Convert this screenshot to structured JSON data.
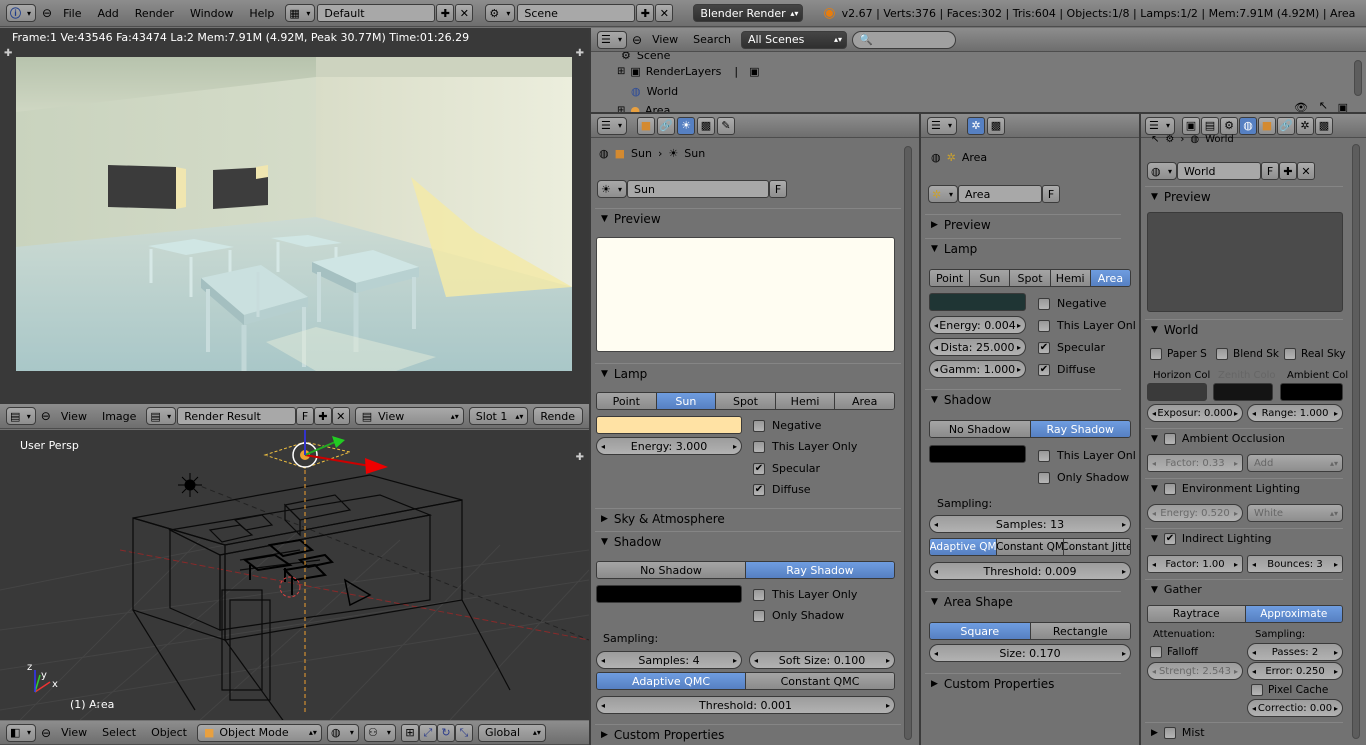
{
  "top_bar": {
    "menus": [
      "File",
      "Add",
      "Render",
      "Window",
      "Help"
    ],
    "screen_layout": "Default",
    "scene": "Scene",
    "engine": "Blender Render",
    "version_stats": "v2.67 | Verts:376 | Faces:302 | Tris:604 | Objects:1/8 | Lamps:1/2 | Mem:7.91M (4.92M) | Area"
  },
  "render_view": {
    "stats": "Frame:1 Ve:43546 Fa:43474 La:2 Mem:7.91M (4.92M, Peak 30.77M) Time:01:26.29"
  },
  "image_editor_header": {
    "menus": [
      "View",
      "Image"
    ],
    "image_name": "Render Result",
    "f_label": "F",
    "view_select": "View",
    "slot": "Slot 1",
    "render_label": "Rende"
  },
  "viewport3d": {
    "view_label": "User Persp",
    "object_label": "(1) Area",
    "axis_x": "x",
    "axis_y": "y",
    "axis_z": "z"
  },
  "viewport_header": {
    "menus": [
      "View",
      "Select",
      "Object"
    ],
    "mode": "Object Mode",
    "orientation": "Global"
  },
  "outliner": {
    "menus": [
      "View",
      "Search"
    ],
    "filter": "All Scenes",
    "items": [
      "Scene",
      "RenderLayers",
      "World",
      "Area"
    ]
  },
  "props_sun": {
    "breadcrumb": [
      "Sun",
      "Sun"
    ],
    "datablock": "Sun",
    "f_label": "F",
    "preview_title": "Preview",
    "lamp_title": "Lamp",
    "lamp_types": [
      "Point",
      "Sun",
      "Spot",
      "Hemi",
      "Area"
    ],
    "active_type": "Sun",
    "energy": "Energy: 3.000",
    "checks": [
      "Negative",
      "This Layer Only",
      "Specular",
      "Diffuse"
    ],
    "sky_title": "Sky & Atmosphere",
    "shadow_title": "Shadow",
    "shadow_types": [
      "No Shadow",
      "Ray Shadow"
    ],
    "shadow_checks": [
      "This Layer Only",
      "Only Shadow"
    ],
    "sampling_label": "Sampling:",
    "samples": "Samples: 4",
    "soft_size": "Soft Size: 0.100",
    "qmc": [
      "Adaptive QMC",
      "Constant QMC"
    ],
    "threshold": "Threshold: 0.001",
    "custom_title": "Custom Properties",
    "color_lamp": "#ffe2a4",
    "color_shadow": "#000000"
  },
  "props_area": {
    "breadcrumb": "Area",
    "datablock": "Area",
    "f_label": "F",
    "preview_title": "Preview",
    "lamp_title": "Lamp",
    "lamp_types": [
      "Point",
      "Sun",
      "Spot",
      "Hemi",
      "Area"
    ],
    "active_type": "Area",
    "checks": [
      "Negative",
      "This Layer Onl",
      "Specular",
      "Diffuse"
    ],
    "energy": "Energy: 0.004",
    "distance": "Dista: 25.000",
    "gamma": "Gamm: 1.000",
    "shadow_title": "Shadow",
    "shadow_types": [
      "No Shadow",
      "Ray Shadow"
    ],
    "shadow_checks": [
      "This Layer Onl",
      "Only Shadow"
    ],
    "sampling_label": "Sampling:",
    "samples": "Samples: 13",
    "qmc": [
      "Adaptive QM",
      "Constant QM",
      "Constant Jitte"
    ],
    "threshold": "Threshold: 0.009",
    "shape_title": "Area Shape",
    "shapes": [
      "Square",
      "Rectangle"
    ],
    "size": "Size: 0.170",
    "custom_title": "Custom Properties",
    "color_lamp": "#1f3534",
    "color_shadow": "#000000"
  },
  "props_world": {
    "breadcrumb": "World",
    "datablock": "World",
    "f_label": "F",
    "preview_title": "Preview",
    "world_title": "World",
    "world_checks": [
      "Paper S",
      "Blend Sk",
      "Real Sky"
    ],
    "color_labels": [
      "Horizon Col",
      "Zenith Colo",
      "Ambient Col"
    ],
    "exposure": "Exposur: 0.000",
    "range": "Range: 1.000",
    "ao_title": "Ambient Occlusion",
    "ao_factor": "Factor: 0.33",
    "ao_blend": "Add",
    "env_title": "Environment Lighting",
    "env_energy": "Energy: 0.520",
    "env_source": "White",
    "indirect_title": "Indirect Lighting",
    "ind_factor": "Factor: 1.00",
    "ind_bounces": "Bounces: 3",
    "gather_title": "Gather",
    "gather_types": [
      "Raytrace",
      "Approximate"
    ],
    "attenuation_label": "Attenuation:",
    "sampling_label": "Sampling:",
    "falloff": "Falloff",
    "strength": "Strengt: 2.543",
    "passes": "Passes: 2",
    "error": "Error: 0.250",
    "pixel_cache": "Pixel Cache",
    "correction": "Correctio: 0.00",
    "mist_title": "Mist",
    "color_horizon": "#3a3a3a",
    "color_zenith": "#141414",
    "color_ambient": "#000000"
  }
}
